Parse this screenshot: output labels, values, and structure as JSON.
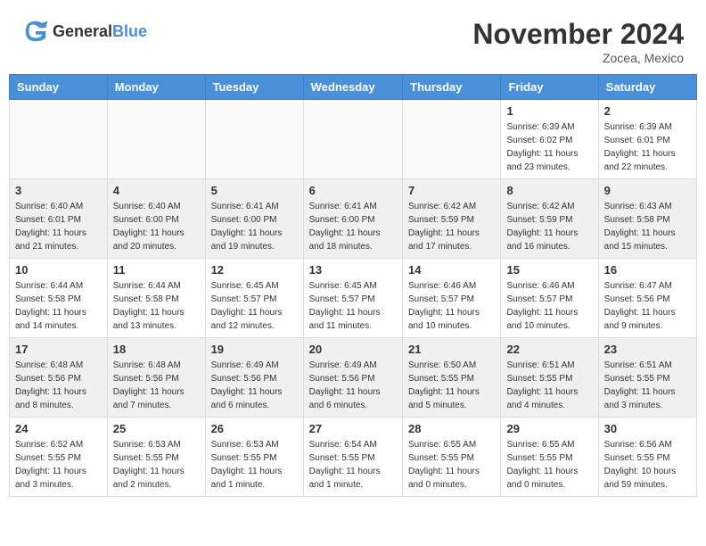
{
  "header": {
    "logo_general": "General",
    "logo_blue": "Blue",
    "title": "November 2024",
    "location": "Zocea, Mexico"
  },
  "days_of_week": [
    "Sunday",
    "Monday",
    "Tuesday",
    "Wednesday",
    "Thursday",
    "Friday",
    "Saturday"
  ],
  "weeks": [
    [
      {
        "day": "",
        "info": ""
      },
      {
        "day": "",
        "info": ""
      },
      {
        "day": "",
        "info": ""
      },
      {
        "day": "",
        "info": ""
      },
      {
        "day": "",
        "info": ""
      },
      {
        "day": "1",
        "info": "Sunrise: 6:39 AM\nSunset: 6:02 PM\nDaylight: 11 hours\nand 23 minutes."
      },
      {
        "day": "2",
        "info": "Sunrise: 6:39 AM\nSunset: 6:01 PM\nDaylight: 11 hours\nand 22 minutes."
      }
    ],
    [
      {
        "day": "3",
        "info": "Sunrise: 6:40 AM\nSunset: 6:01 PM\nDaylight: 11 hours\nand 21 minutes."
      },
      {
        "day": "4",
        "info": "Sunrise: 6:40 AM\nSunset: 6:00 PM\nDaylight: 11 hours\nand 20 minutes."
      },
      {
        "day": "5",
        "info": "Sunrise: 6:41 AM\nSunset: 6:00 PM\nDaylight: 11 hours\nand 19 minutes."
      },
      {
        "day": "6",
        "info": "Sunrise: 6:41 AM\nSunset: 6:00 PM\nDaylight: 11 hours\nand 18 minutes."
      },
      {
        "day": "7",
        "info": "Sunrise: 6:42 AM\nSunset: 5:59 PM\nDaylight: 11 hours\nand 17 minutes."
      },
      {
        "day": "8",
        "info": "Sunrise: 6:42 AM\nSunset: 5:59 PM\nDaylight: 11 hours\nand 16 minutes."
      },
      {
        "day": "9",
        "info": "Sunrise: 6:43 AM\nSunset: 5:58 PM\nDaylight: 11 hours\nand 15 minutes."
      }
    ],
    [
      {
        "day": "10",
        "info": "Sunrise: 6:44 AM\nSunset: 5:58 PM\nDaylight: 11 hours\nand 14 minutes."
      },
      {
        "day": "11",
        "info": "Sunrise: 6:44 AM\nSunset: 5:58 PM\nDaylight: 11 hours\nand 13 minutes."
      },
      {
        "day": "12",
        "info": "Sunrise: 6:45 AM\nSunset: 5:57 PM\nDaylight: 11 hours\nand 12 minutes."
      },
      {
        "day": "13",
        "info": "Sunrise: 6:45 AM\nSunset: 5:57 PM\nDaylight: 11 hours\nand 11 minutes."
      },
      {
        "day": "14",
        "info": "Sunrise: 6:46 AM\nSunset: 5:57 PM\nDaylight: 11 hours\nand 10 minutes."
      },
      {
        "day": "15",
        "info": "Sunrise: 6:46 AM\nSunset: 5:57 PM\nDaylight: 11 hours\nand 10 minutes."
      },
      {
        "day": "16",
        "info": "Sunrise: 6:47 AM\nSunset: 5:56 PM\nDaylight: 11 hours\nand 9 minutes."
      }
    ],
    [
      {
        "day": "17",
        "info": "Sunrise: 6:48 AM\nSunset: 5:56 PM\nDaylight: 11 hours\nand 8 minutes."
      },
      {
        "day": "18",
        "info": "Sunrise: 6:48 AM\nSunset: 5:56 PM\nDaylight: 11 hours\nand 7 minutes."
      },
      {
        "day": "19",
        "info": "Sunrise: 6:49 AM\nSunset: 5:56 PM\nDaylight: 11 hours\nand 6 minutes."
      },
      {
        "day": "20",
        "info": "Sunrise: 6:49 AM\nSunset: 5:56 PM\nDaylight: 11 hours\nand 6 minutes."
      },
      {
        "day": "21",
        "info": "Sunrise: 6:50 AM\nSunset: 5:55 PM\nDaylight: 11 hours\nand 5 minutes."
      },
      {
        "day": "22",
        "info": "Sunrise: 6:51 AM\nSunset: 5:55 PM\nDaylight: 11 hours\nand 4 minutes."
      },
      {
        "day": "23",
        "info": "Sunrise: 6:51 AM\nSunset: 5:55 PM\nDaylight: 11 hours\nand 3 minutes."
      }
    ],
    [
      {
        "day": "24",
        "info": "Sunrise: 6:52 AM\nSunset: 5:55 PM\nDaylight: 11 hours\nand 3 minutes."
      },
      {
        "day": "25",
        "info": "Sunrise: 6:53 AM\nSunset: 5:55 PM\nDaylight: 11 hours\nand 2 minutes."
      },
      {
        "day": "26",
        "info": "Sunrise: 6:53 AM\nSunset: 5:55 PM\nDaylight: 11 hours\nand 1 minute."
      },
      {
        "day": "27",
        "info": "Sunrise: 6:54 AM\nSunset: 5:55 PM\nDaylight: 11 hours\nand 1 minute."
      },
      {
        "day": "28",
        "info": "Sunrise: 6:55 AM\nSunset: 5:55 PM\nDaylight: 11 hours\nand 0 minutes."
      },
      {
        "day": "29",
        "info": "Sunrise: 6:55 AM\nSunset: 5:55 PM\nDaylight: 11 hours\nand 0 minutes."
      },
      {
        "day": "30",
        "info": "Sunrise: 6:56 AM\nSunset: 5:55 PM\nDaylight: 10 hours\nand 59 minutes."
      }
    ]
  ]
}
